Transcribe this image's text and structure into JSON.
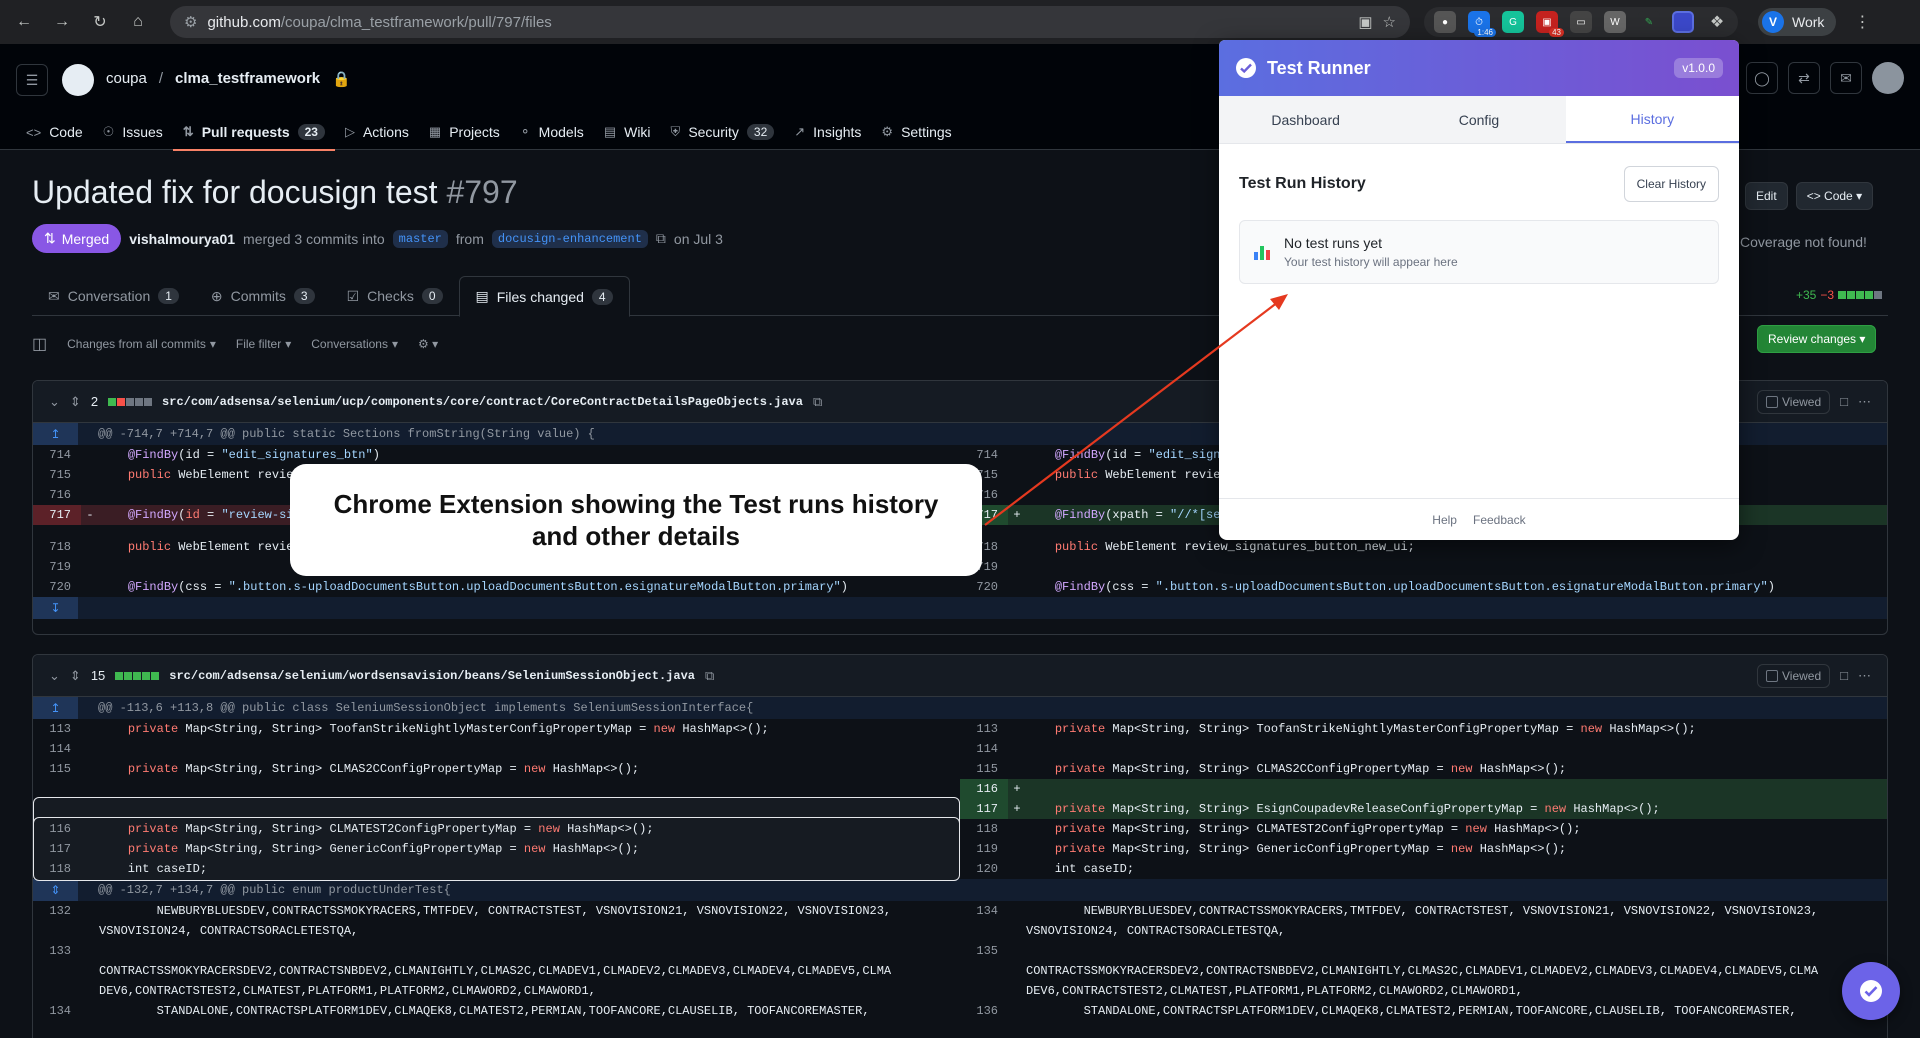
{
  "browser": {
    "url_host": "github.com",
    "url_path": "/coupa/clma_testframework/pull/797/files",
    "ext_badge_time": "1:46",
    "ext_badge_count": "43",
    "profile_initial": "V",
    "profile_label": "Work"
  },
  "repo": {
    "owner": "coupa",
    "name": "clma_testframework",
    "tabs": [
      {
        "label": "Code",
        "icon": "code-icon"
      },
      {
        "label": "Issues",
        "icon": "issue-icon"
      },
      {
        "label": "Pull requests",
        "count": "23",
        "icon": "pr-icon"
      },
      {
        "label": "Actions",
        "icon": "play-icon"
      },
      {
        "label": "Projects",
        "icon": "table-icon"
      },
      {
        "label": "Models",
        "icon": "models-icon"
      },
      {
        "label": "Wiki",
        "icon": "book-icon"
      },
      {
        "label": "Security",
        "count": "32",
        "icon": "shield-icon"
      },
      {
        "label": "Insights",
        "icon": "graph-icon"
      },
      {
        "label": "Settings",
        "icon": "gear-icon"
      }
    ]
  },
  "pr": {
    "title": "Updated fix for docusign test",
    "number": "#797",
    "state": "Merged",
    "author": "vishalmourya01",
    "merge_text": "merged 3 commits into",
    "base": "master",
    "from_text": "from",
    "head": "docusign-enhancement",
    "date": "on Jul 3",
    "tabs": [
      {
        "label": "Conversation",
        "count": "1"
      },
      {
        "label": "Commits",
        "count": "3"
      },
      {
        "label": "Checks",
        "count": "0"
      },
      {
        "label": "Files changed",
        "count": "4"
      }
    ],
    "edit_label": "Edit",
    "code_label": "Code",
    "coverage_text": "Coverage not found!",
    "diffstat_add": "+35",
    "diffstat_del": "−3",
    "review_label": "Review changes"
  },
  "filter": {
    "changes": "Changes from all commits",
    "file_filter": "File filter",
    "conversations": "Conversations"
  },
  "files": [
    {
      "count": "2",
      "path": "src/com/adsensa/selenium/ucp/components/core/contract/CoreContractDetailsPageObjects.java",
      "viewed": "Viewed",
      "hunk": "@@ -714,7 +714,7 @@ public static Sections fromString(String value) {"
    },
    {
      "count": "15",
      "path": "src/com/adsensa/selenium/wordsensavision/beans/SeleniumSessionObject.java",
      "viewed": "Viewed",
      "hunk": "@@ -113,6 +113,8 @@ public class SeleniumSessionObject implements SeleniumSessionInterface{",
      "hunk2": "@@ -132,7 +134,7 @@ public enum productUnderTest{"
    }
  ],
  "popup": {
    "title": "Test Runner",
    "version": "v1.0.0",
    "tabs": [
      "Dashboard",
      "Config",
      "History"
    ],
    "section_title": "Test Run History",
    "clear_label": "Clear History",
    "empty_title": "No test runs yet",
    "empty_sub": "Your test history will appear here",
    "footer_help": "Help",
    "footer_feedback": "Feedback"
  },
  "callout": {
    "line1": "Chrome Extension showing the Test runs history",
    "line2": "and other details"
  },
  "colors": {
    "accent": "#5b6ee0",
    "merged": "#8957e5",
    "arrow": "#e5391f"
  }
}
